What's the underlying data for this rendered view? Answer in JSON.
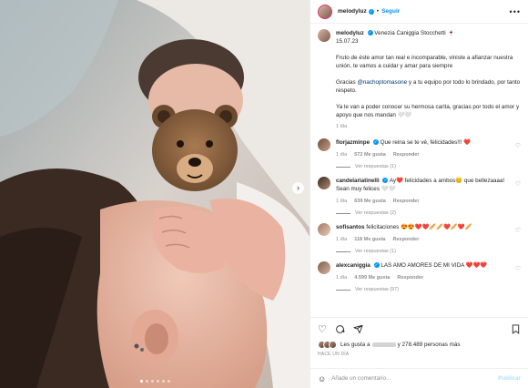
{
  "post": {
    "username": "melodyluz",
    "follow_label": "Seguir",
    "more_label": "•••",
    "separator": "•"
  },
  "caption": {
    "username": "melodyluz",
    "line1": "Venezia Caniggia Stocchetti",
    "date": "15.07.23",
    "para1": "Fruto de éste amor tan real e incomparable, viniste a afianzar nuestra unión, te vamos a cuidar y amar para siempre",
    "para2_prefix": "Gracias",
    "para2_mention": "@nachoptomasone",
    "para2_suffix": "y a tu equipo por todo lo brindado, por tanto respeto.",
    "para3": "Ya le van a poder conocer su hermosa carita, gracias por todo el amor y apoyo que nos mandan 🤍🤍",
    "time": "1 día"
  },
  "comments": [
    {
      "user": "florjazminpe",
      "text": "Que reina se te vé, felicidades!!! ❤️",
      "time": "1 día",
      "likes": "572 Me gusta",
      "reply": "Responder",
      "replies": "Ver respuestas (1)"
    },
    {
      "user": "candelariatinelli",
      "text": "Ay❤️ felicidades a ambos😊 que bellezaaaa! Sean muy felices 🤍🤍",
      "time": "1 día",
      "likes": "639 Me gusta",
      "reply": "Responder",
      "replies": "Ver respuestas (2)"
    },
    {
      "user": "sofisantos",
      "text": "felicitaciones 😍😍❤️❤️🥖🥖❤️🥖❤️🥖",
      "time": "1 día",
      "likes": "118 Me gusta",
      "reply": "Responder",
      "replies": "Ver respuestas (1)"
    },
    {
      "user": "alexcaniggia",
      "text": "LAS AMO AMORES DE MI VIDA ❤️❤️❤️",
      "time": "1 día",
      "likes": "4.599 Me gusta",
      "reply": "Responder",
      "replies": "Ver respuestas (97)"
    }
  ],
  "likes": {
    "prefix": "Les gusta a",
    "suffix": "y 278.489 personas más",
    "ago": "HACE UN DÍA"
  },
  "add_comment": {
    "placeholder": "Añade un comentario...",
    "publish": "Publicar"
  },
  "icons": {
    "like": "heart-icon",
    "comment": "comment-icon",
    "share": "share-icon",
    "save": "bookmark-icon"
  }
}
